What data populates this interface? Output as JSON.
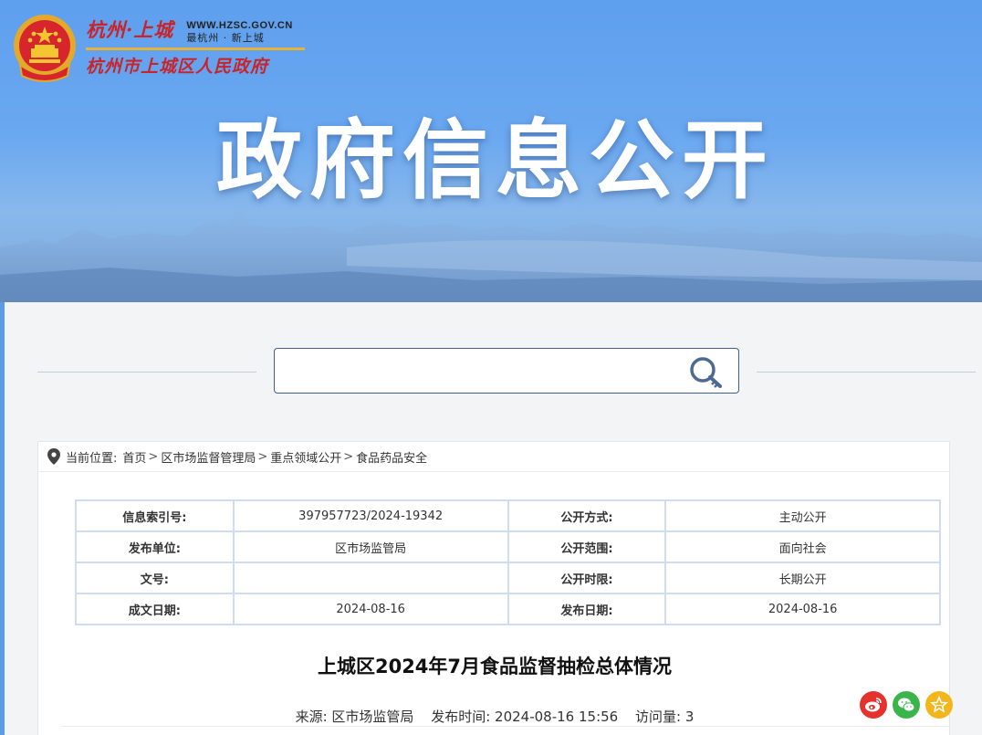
{
  "header": {
    "brand_city": "杭州·上城",
    "url": "WWW.HZSC.GOV.CN",
    "slogan": "最杭州 · 新上城",
    "gov_name": "杭州市上城区人民政府",
    "banner_title": "政府信息公开"
  },
  "search": {
    "value": "",
    "placeholder": ""
  },
  "breadcrumb": {
    "label": "当前位置:",
    "items": [
      "首页",
      "区市场监督管理局",
      "重点领域公开",
      "食品药品安全"
    ],
    "separator": ">"
  },
  "meta_table": {
    "rows": [
      {
        "k1": "信息索引号:",
        "v1": "397957723/2024-19342",
        "k2": "公开方式:",
        "v2": "主动公开"
      },
      {
        "k1": "发布单位:",
        "v1": "区市场监管局",
        "k2": "公开范围:",
        "v2": "面向社会"
      },
      {
        "k1": "文号:",
        "v1": "",
        "k2": "公开时限:",
        "v2": "长期公开"
      },
      {
        "k1": "成文日期:",
        "v1": "2024-08-16",
        "k2": "发布日期:",
        "v2": "2024-08-16"
      }
    ]
  },
  "article": {
    "title": "上城区2024年7月食品监督抽检总体情况",
    "source": "来源: 区市场监管局",
    "publish_time": "发布时间:  2024-08-16 15:56",
    "views": "访问量:  3"
  },
  "share": {
    "icons": [
      "weibo-icon",
      "wechat-icon",
      "favorite-icon"
    ],
    "colors": {
      "weibo": "#e5322d",
      "wechat": "#3ab54a",
      "favorite": "#f2b51b"
    }
  },
  "colors": {
    "banner": "#5e9fee",
    "panel": "#f3f4f6",
    "table_border": "#cfdcf2",
    "search_border": "#3d5f94",
    "brand_red": "#c8242a"
  }
}
